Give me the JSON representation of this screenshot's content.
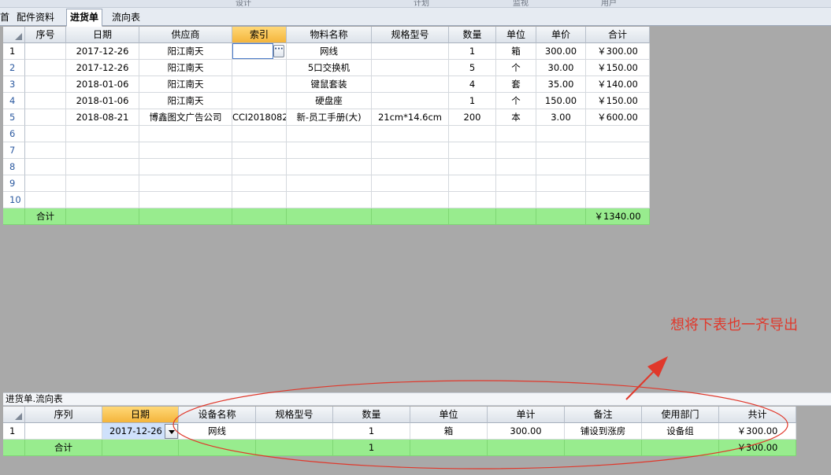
{
  "top_menu_partial": [
    "设计",
    "计划",
    "监视",
    "用户"
  ],
  "tabs": [
    {
      "label": "首",
      "active": false
    },
    {
      "label": "配件资料",
      "active": false
    },
    {
      "label": "进货单",
      "active": true
    },
    {
      "label": "流向表",
      "active": false
    }
  ],
  "main_grid": {
    "columns": [
      "序号",
      "日期",
      "供应商",
      "索引",
      "物料名称",
      "规格型号",
      "数量",
      "单位",
      "单价",
      "合计"
    ],
    "selected_column": "索引",
    "rows": [
      {
        "num": "1",
        "seq": "",
        "date": "2017-12-26",
        "supplier": "阳江南天",
        "index": "",
        "name": "网线",
        "spec": "",
        "qty": "1",
        "unit": "箱",
        "price": "300.00",
        "total": "￥300.00"
      },
      {
        "num": "2",
        "seq": "",
        "date": "2017-12-26",
        "supplier": "阳江南天",
        "index": "",
        "name": "5口交换机",
        "spec": "",
        "qty": "5",
        "unit": "个",
        "price": "30.00",
        "total": "￥150.00"
      },
      {
        "num": "3",
        "seq": "",
        "date": "2018-01-06",
        "supplier": "阳江南天",
        "index": "",
        "name": "键鼠套装",
        "spec": "",
        "qty": "4",
        "unit": "套",
        "price": "35.00",
        "total": "￥140.00"
      },
      {
        "num": "4",
        "seq": "",
        "date": "2018-01-06",
        "supplier": "阳江南天",
        "index": "",
        "name": "硬盘座",
        "spec": "",
        "qty": "1",
        "unit": "个",
        "price": "150.00",
        "total": "￥150.00"
      },
      {
        "num": "5",
        "seq": "",
        "date": "2018-08-21",
        "supplier": "博鑫图文广告公司",
        "index": "CCI2018082",
        "name": "新-员工手册(大)",
        "spec": "21cm*14.6cm",
        "qty": "200",
        "unit": "本",
        "price": "3.00",
        "total": "￥600.00"
      },
      {
        "num": "6",
        "seq": "",
        "date": "",
        "supplier": "",
        "index": "",
        "name": "",
        "spec": "",
        "qty": "",
        "unit": "",
        "price": "",
        "total": ""
      },
      {
        "num": "7",
        "seq": "",
        "date": "",
        "supplier": "",
        "index": "",
        "name": "",
        "spec": "",
        "qty": "",
        "unit": "",
        "price": "",
        "total": ""
      },
      {
        "num": "8",
        "seq": "",
        "date": "",
        "supplier": "",
        "index": "",
        "name": "",
        "spec": "",
        "qty": "",
        "unit": "",
        "price": "",
        "total": ""
      },
      {
        "num": "9",
        "seq": "",
        "date": "",
        "supplier": "",
        "index": "",
        "name": "",
        "spec": "",
        "qty": "",
        "unit": "",
        "price": "",
        "total": ""
      },
      {
        "num": "10",
        "seq": "",
        "date": "",
        "supplier": "",
        "index": "",
        "name": "",
        "spec": "",
        "qty": "",
        "unit": "",
        "price": "",
        "total": ""
      }
    ],
    "footer": {
      "label": "合计",
      "grand_total": "￥1340.00"
    }
  },
  "detail_caption": "进货单.流向表",
  "detail_grid": {
    "columns": [
      "序列",
      "日期",
      "设备名称",
      "规格型号",
      "数量",
      "单位",
      "单计",
      "备注",
      "使用部门",
      "共计"
    ],
    "selected_column": "日期",
    "rows": [
      {
        "num": "1",
        "seq": "",
        "date": "2017-12-26",
        "device": "网线",
        "spec": "",
        "qty": "1",
        "unit": "箱",
        "price": "300.00",
        "remark": "铺设到涨房",
        "dept": "设备组",
        "total": "￥300.00"
      }
    ],
    "footer": {
      "label": "合计",
      "qty": "1",
      "total": "￥300.00"
    }
  },
  "annotation_text": "想将下表也一齐导出",
  "colors": {
    "annotation": "#e0382b",
    "total_row": "#98ec8e",
    "selected_header": "#f4b53c",
    "workspace": "#a9a9a9"
  }
}
